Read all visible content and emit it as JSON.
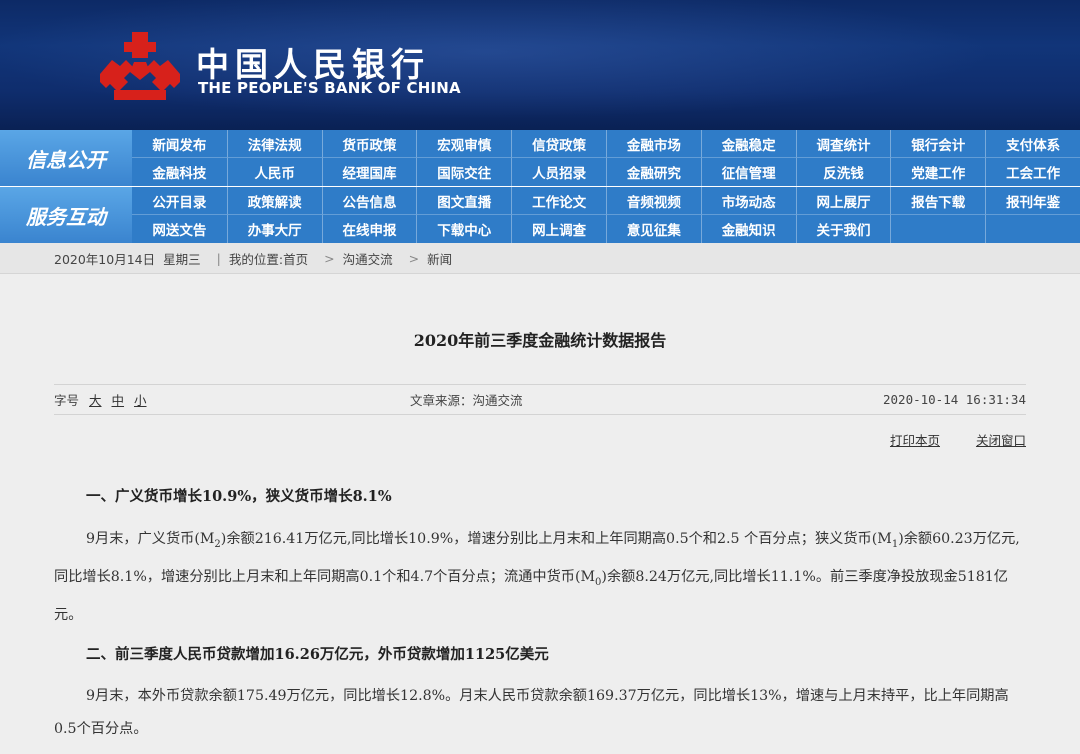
{
  "header": {
    "bank_name_cn": "中国人民银行",
    "bank_name_en": "THE PEOPLE'S BANK OF CHINA",
    "emblem_color": "#d7211b"
  },
  "nav": {
    "group1_label": "信息公开",
    "group1_items": [
      "新闻发布",
      "法律法规",
      "货币政策",
      "宏观审慎",
      "信贷政策",
      "金融市场",
      "金融稳定",
      "调查统计",
      "银行会计",
      "支付体系",
      "金融科技",
      "人民币",
      "经理国库",
      "国际交往",
      "人员招录",
      "金融研究",
      "征信管理",
      "反洗钱",
      "党建工作",
      "工会工作"
    ],
    "group2_label": "服务互动",
    "group2_items": [
      "公开目录",
      "政策解读",
      "公告信息",
      "图文直播",
      "工作论文",
      "音频视频",
      "市场动态",
      "网上展厅",
      "报告下载",
      "报刊年鉴",
      "网送文告",
      "办事大厅",
      "在线申报",
      "下载中心",
      "网上调查",
      "意见征集",
      "金融知识",
      "关于我们",
      "",
      ""
    ]
  },
  "breadcrumb": {
    "date": "2020年10月14日",
    "weekday": "星期三",
    "location_label": "我的位置:首页",
    "level2": "沟通交流",
    "level3": "新闻"
  },
  "article": {
    "title": "2020年前三季度金融统计数据报告",
    "font_size_label": "字号",
    "size_large": "大",
    "size_medium": "中",
    "size_small": "小",
    "source": "文章来源：沟通交流",
    "datetime": "2020-10-14 16:31:34",
    "print_link": "打印本页",
    "close_link": "关闭窗口",
    "section1_heading": "一、广义货币增长10.9%，狭义货币增长8.1%",
    "section1_para_a": "9月末，广义货币(M",
    "section1_sub_a": "2",
    "section1_para_b": ")余额216.41万亿元,同比增长10.9%，增速分别比上月末和上年同期高0.5个和2.5 个百分点；狭义货币(M",
    "section1_sub_b": "1",
    "section1_para_c": ")余额60.23万亿元,同比增长8.1%，增速分别比上月末和上年同期高0.1个和4.7个百分点；流通中货币(M",
    "section1_sub_c": "0",
    "section1_para_d": ")余额8.24万亿元,同比增长11.1%。前三季度净投放现金5181亿元。",
    "section2_heading": "二、前三季度人民币贷款增加16.26万亿元，外币贷款增加1125亿美元",
    "section2_para": "9月末，本外币贷款余额175.49万亿元，同比增长12.8%。月末人民币贷款余额169.37万亿元，同比增长13%，增速与上月末持平，比上年同期高0.5个百分点。"
  }
}
